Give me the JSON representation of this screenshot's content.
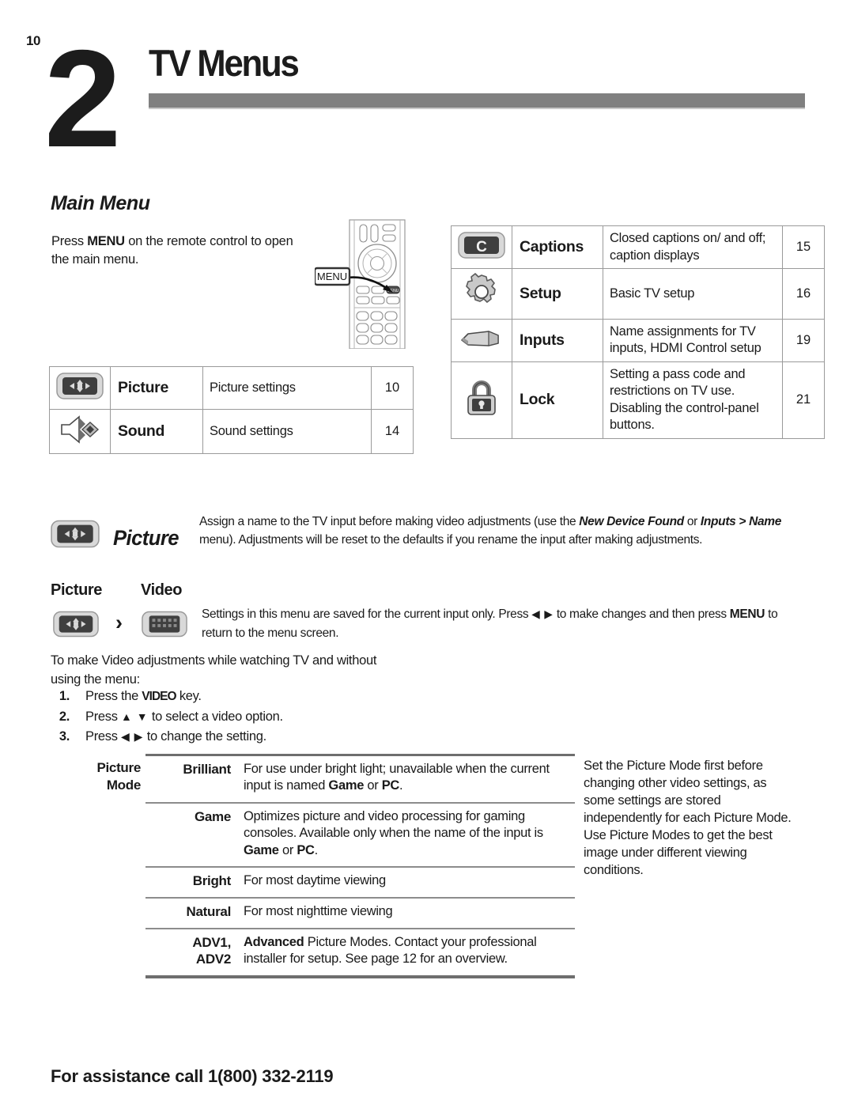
{
  "header": {
    "page_number": "10",
    "chapter_number": "2",
    "chapter_title": "TV Menus"
  },
  "main_menu": {
    "heading": "Main Menu",
    "intro_prefix": "Press ",
    "intro_key": "MENU",
    "intro_suffix": " on the remote control to open the main menu.",
    "remote_callout": "MENU",
    "remote_button_label": "MENU"
  },
  "menu_table_left": {
    "rows": [
      {
        "icon": "picture-icon",
        "name": "Picture",
        "desc": "Picture settings",
        "page": "10"
      },
      {
        "icon": "sound-icon",
        "name": "Sound",
        "desc": "Sound settings",
        "page": "14"
      }
    ]
  },
  "menu_table_right": {
    "rows": [
      {
        "icon": "captions-icon",
        "name": "Captions",
        "desc": "Closed captions on/ and off; caption displays",
        "page": "15"
      },
      {
        "icon": "setup-gear-icon",
        "name": "Setup",
        "desc": "Basic TV setup",
        "page": "16"
      },
      {
        "icon": "inputs-plug-icon",
        "name": "Inputs",
        "desc": "Name assignments for TV inputs, HDMI Control setup",
        "page": "19"
      },
      {
        "icon": "lock-padlock-icon",
        "name": "Lock",
        "desc": "Setting a pass code and restrictions on TV use.  Disabling the control-panel buttons.",
        "page": "21"
      }
    ]
  },
  "picture_section": {
    "title": "Picture",
    "body_1": "Assign a name to the TV input before making video adjustments (use the ",
    "body_em_1": "New Device Found",
    "body_2": " or ",
    "body_em_2": "Inputs > Name",
    "body_3": " menu).  Adjustments will be reset to the defaults if you rename the input after making adjustments.",
    "label_picture": "Picture",
    "label_video": "Video",
    "chevron": "›",
    "pv_body_1": "Settings in this menu are saved for the current input only.  Press ",
    "pv_arrows": "◀ ▶",
    "pv_body_2": " to make changes and then press ",
    "pv_key": "MENU",
    "pv_body_3": " to return to the menu screen.",
    "video_adjust_text": "To make Video adjustments while watching TV and without using the menu:",
    "steps": [
      {
        "num": "1.",
        "pre": "Press the ",
        "key": "VIDEO",
        "post": " key."
      },
      {
        "num": "2.",
        "pre": "Press ",
        "key": "▲ ▼",
        "post": " to select a video option."
      },
      {
        "num": "3.",
        "pre": "Press ",
        "key": "◀ ▶",
        "post": " to change the setting."
      }
    ]
  },
  "picture_mode": {
    "row_label_line1": "Picture",
    "row_label_line2": "Mode",
    "rows": [
      {
        "name": "Brilliant",
        "desc_1": "For use under bright light; unavailable when the current input is named ",
        "em_1": "Game",
        "desc_2": " or ",
        "em_2": "PC",
        "desc_3": "."
      },
      {
        "name": "Game",
        "desc_1": "Optimizes picture and video processing for gaming consoles.  Available only when the name of the input is ",
        "em_1": "Game",
        "desc_2": " or ",
        "em_2": "PC",
        "desc_3": "."
      },
      {
        "name": "Bright",
        "desc_1": "For most daytime viewing",
        "em_1": "",
        "desc_2": "",
        "em_2": "",
        "desc_3": ""
      },
      {
        "name": "Natural",
        "desc_1": "For most nighttime viewing",
        "em_1": "",
        "desc_2": "",
        "em_2": "",
        "desc_3": ""
      },
      {
        "name": "ADV1, ADV2",
        "name_line1": "ADV1,",
        "name_line2": "ADV2",
        "em_lead": "Advanced",
        "desc_1": " Picture Modes.  Contact your professional installer for setup.  See page 12 for an overview.",
        "em_1": "",
        "desc_2": "",
        "em_2": "",
        "desc_3": ""
      }
    ],
    "sidenote": "Set the Picture Mode first before changing other video settings, as some settings are stored independently for each Picture Mode.  Use Picture Modes to get the best image under different viewing conditions."
  },
  "footer": {
    "assistance": "For assistance call 1(800) 332-2119"
  }
}
